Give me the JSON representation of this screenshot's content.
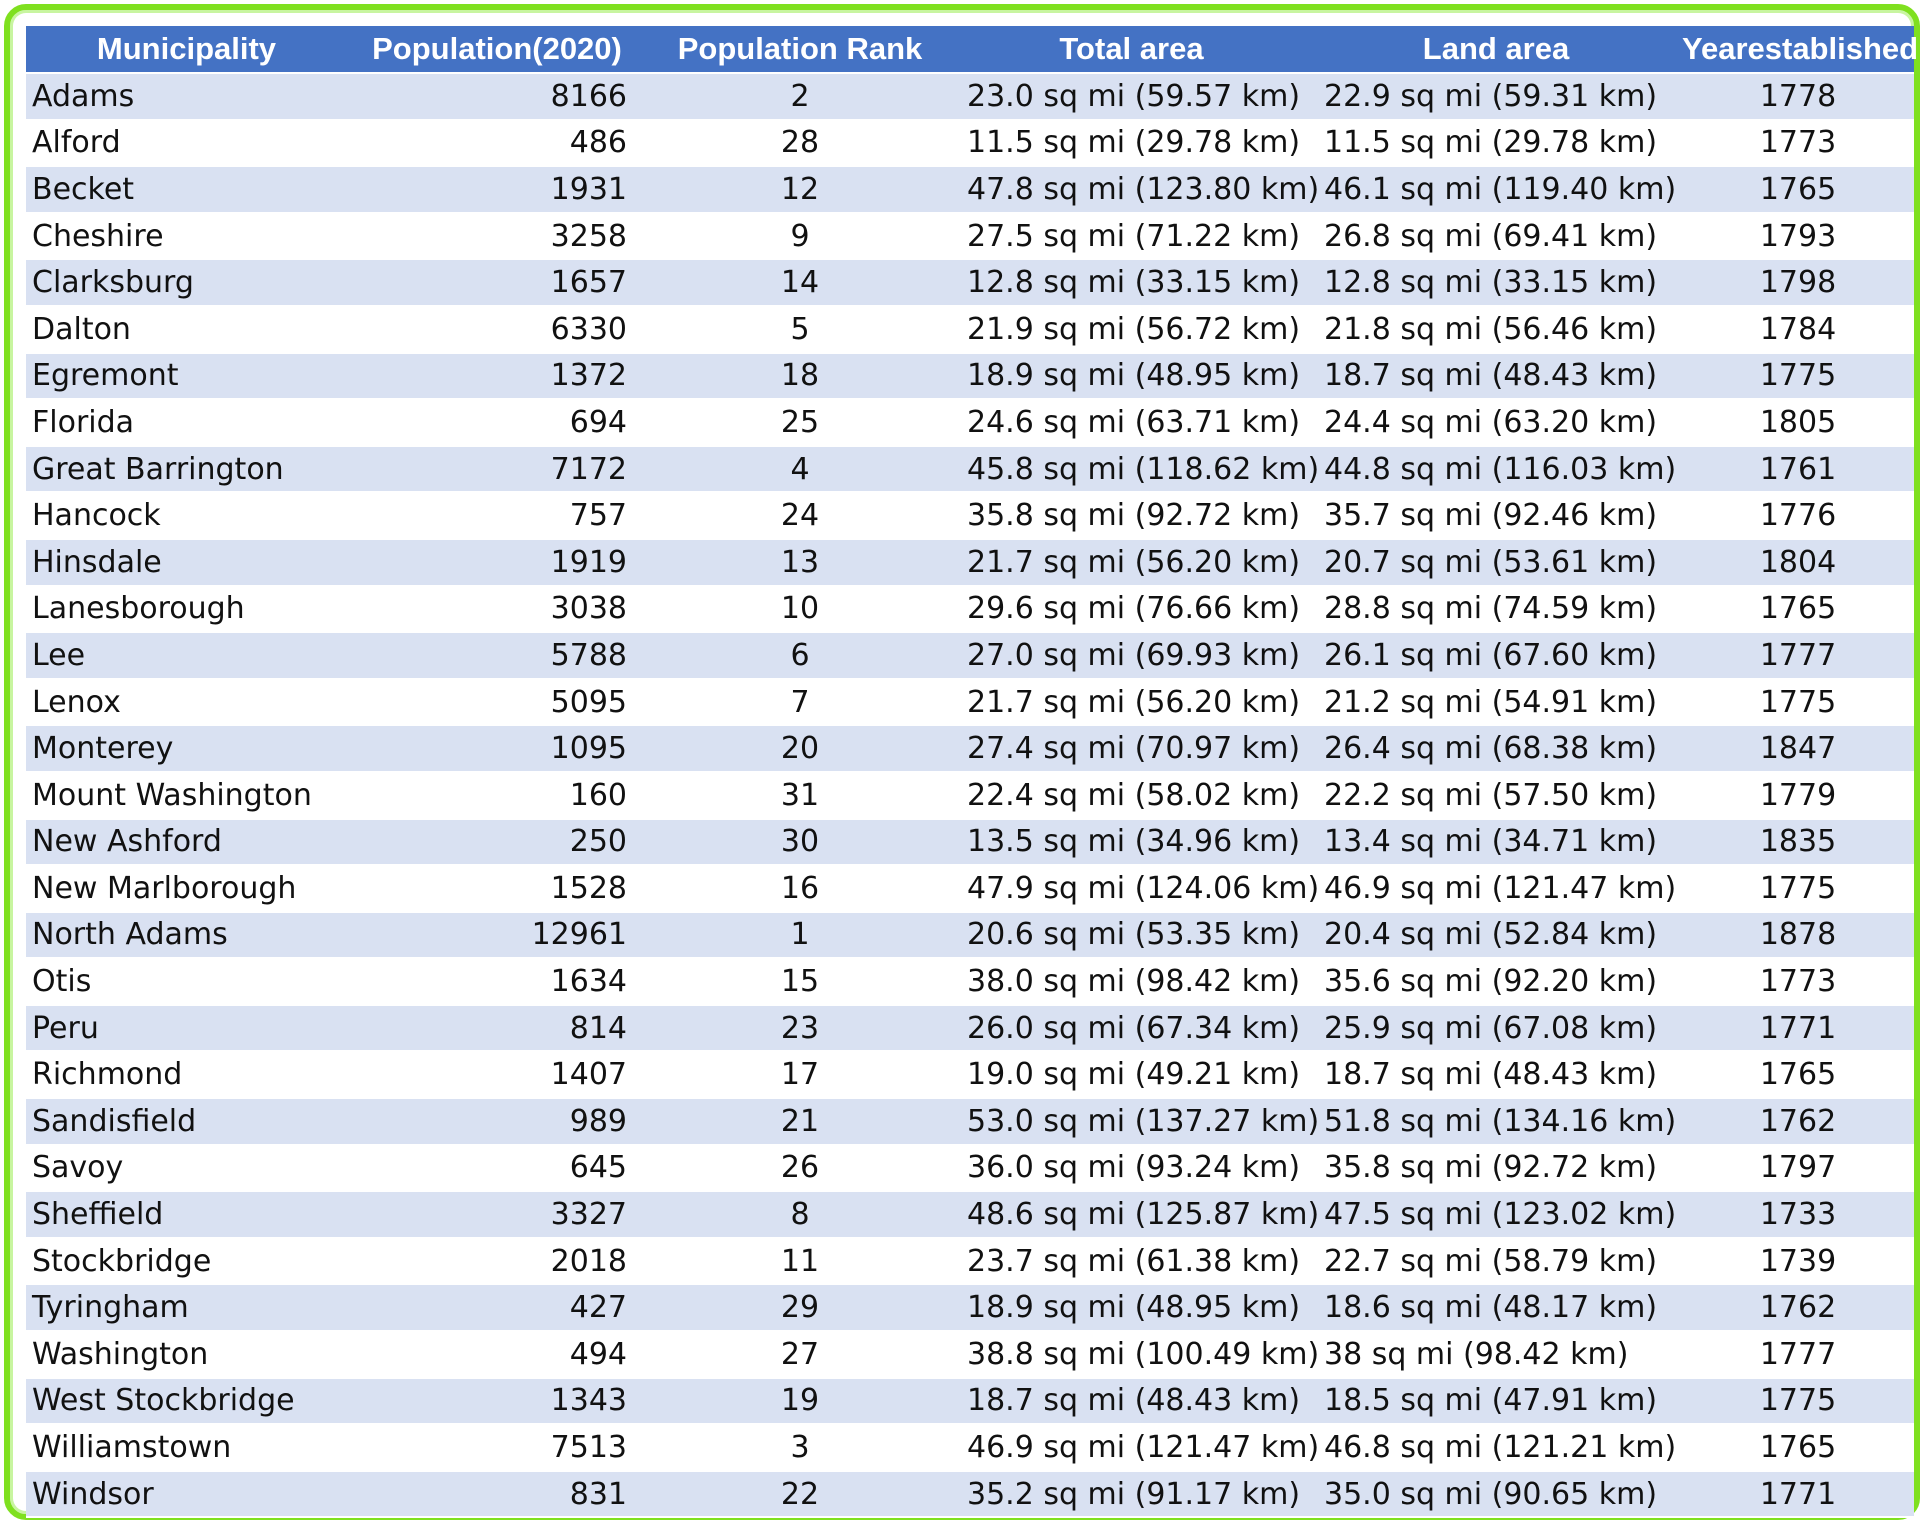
{
  "headers": [
    "Municipality",
    "Population(2020)",
    "Population Rank",
    "Total area",
    "Land area",
    "Yearestablished"
  ],
  "rows": [
    [
      "Adams",
      "8166",
      "2",
      "23.0 sq mi (59.57 km)",
      "22.9 sq mi (59.31 km)",
      "1778"
    ],
    [
      "Alford",
      "486",
      "28",
      "11.5 sq mi (29.78 km)",
      "11.5 sq mi (29.78 km)",
      "1773"
    ],
    [
      "Becket",
      "1931",
      "12",
      "47.8 sq mi (123.80 km)",
      "46.1 sq mi (119.40 km)",
      "1765"
    ],
    [
      "Cheshire",
      "3258",
      "9",
      "27.5 sq mi (71.22 km)",
      "26.8 sq mi (69.41 km)",
      "1793"
    ],
    [
      "Clarksburg",
      "1657",
      "14",
      "12.8 sq mi (33.15 km)",
      "12.8 sq mi (33.15 km)",
      "1798"
    ],
    [
      "Dalton",
      "6330",
      "5",
      "21.9 sq mi (56.72 km)",
      "21.8 sq mi (56.46 km)",
      "1784"
    ],
    [
      "Egremont",
      "1372",
      "18",
      "18.9 sq mi (48.95 km)",
      "18.7 sq mi (48.43 km)",
      "1775"
    ],
    [
      "Florida",
      "694",
      "25",
      "24.6 sq mi (63.71 km)",
      "24.4 sq mi (63.20 km)",
      "1805"
    ],
    [
      "Great Barrington",
      "7172",
      "4",
      "45.8 sq mi (118.62 km)",
      "44.8 sq mi (116.03 km)",
      "1761"
    ],
    [
      "Hancock",
      "757",
      "24",
      "35.8 sq mi (92.72 km)",
      "35.7 sq mi (92.46 km)",
      "1776"
    ],
    [
      "Hinsdale",
      "1919",
      "13",
      "21.7 sq mi (56.20 km)",
      "20.7 sq mi (53.61 km)",
      "1804"
    ],
    [
      "Lanesborough",
      "3038",
      "10",
      "29.6 sq mi (76.66 km)",
      "28.8 sq mi (74.59 km)",
      "1765"
    ],
    [
      "Lee",
      "5788",
      "6",
      "27.0 sq mi (69.93 km)",
      "26.1 sq mi (67.60 km)",
      "1777"
    ],
    [
      "Lenox",
      "5095",
      "7",
      "21.7 sq mi (56.20 km)",
      "21.2 sq mi (54.91 km)",
      "1775"
    ],
    [
      "Monterey",
      "1095",
      "20",
      "27.4 sq mi (70.97 km)",
      "26.4 sq mi (68.38 km)",
      "1847"
    ],
    [
      "Mount Washington",
      "160",
      "31",
      "22.4 sq mi (58.02 km)",
      "22.2 sq mi (57.50 km)",
      "1779"
    ],
    [
      "New Ashford",
      "250",
      "30",
      "13.5 sq mi (34.96 km)",
      "13.4 sq mi (34.71 km)",
      "1835"
    ],
    [
      "New Marlborough",
      "1528",
      "16",
      "47.9 sq mi (124.06 km)",
      "46.9 sq mi (121.47 km)",
      "1775"
    ],
    [
      "North Adams",
      "12961",
      "1",
      "20.6 sq mi (53.35 km)",
      "20.4 sq mi (52.84 km)",
      "1878"
    ],
    [
      "Otis",
      "1634",
      "15",
      "38.0 sq mi (98.42 km)",
      "35.6 sq mi (92.20 km)",
      "1773"
    ],
    [
      "Peru",
      "814",
      "23",
      "26.0 sq mi (67.34 km)",
      "25.9 sq mi (67.08 km)",
      "1771"
    ],
    [
      "Richmond",
      "1407",
      "17",
      "19.0 sq mi (49.21 km)",
      "18.7 sq mi (48.43 km)",
      "1765"
    ],
    [
      "Sandisfield",
      "989",
      "21",
      "53.0 sq mi (137.27 km)",
      "51.8 sq mi (134.16 km)",
      "1762"
    ],
    [
      "Savoy",
      "645",
      "26",
      "36.0 sq mi (93.24 km)",
      "35.8 sq mi (92.72 km)",
      "1797"
    ],
    [
      "Sheffield",
      "3327",
      "8",
      "48.6 sq mi (125.87 km)",
      "47.5 sq mi (123.02 km)",
      "1733"
    ],
    [
      "Stockbridge",
      "2018",
      "11",
      "23.7 sq mi (61.38 km)",
      "22.7 sq mi (58.79 km)",
      "1739"
    ],
    [
      "Tyringham",
      "427",
      "29",
      "18.9 sq mi (48.95 km)",
      "18.6 sq mi (48.17 km)",
      "1762"
    ],
    [
      "Washington",
      "494",
      "27",
      "38.8 sq mi (100.49 km)",
      "38 sq mi (98.42 km)",
      "1777"
    ],
    [
      "West Stockbridge",
      "1343",
      "19",
      "18.7 sq mi (48.43 km)",
      "18.5 sq mi (47.91 km)",
      "1775"
    ],
    [
      "Williamstown",
      "7513",
      "3",
      "46.9 sq mi (121.47 km)",
      "46.8 sq mi (121.21 km)",
      "1765"
    ],
    [
      "Windsor",
      "831",
      "22",
      "35.2 sq mi (91.17 km)",
      "35.0 sq mi (90.65 km)",
      "1771"
    ]
  ],
  "colors": {
    "header_bg": "#4472c4",
    "band_bg": "#d9e1f2",
    "frame_border": "#7fe01f"
  }
}
